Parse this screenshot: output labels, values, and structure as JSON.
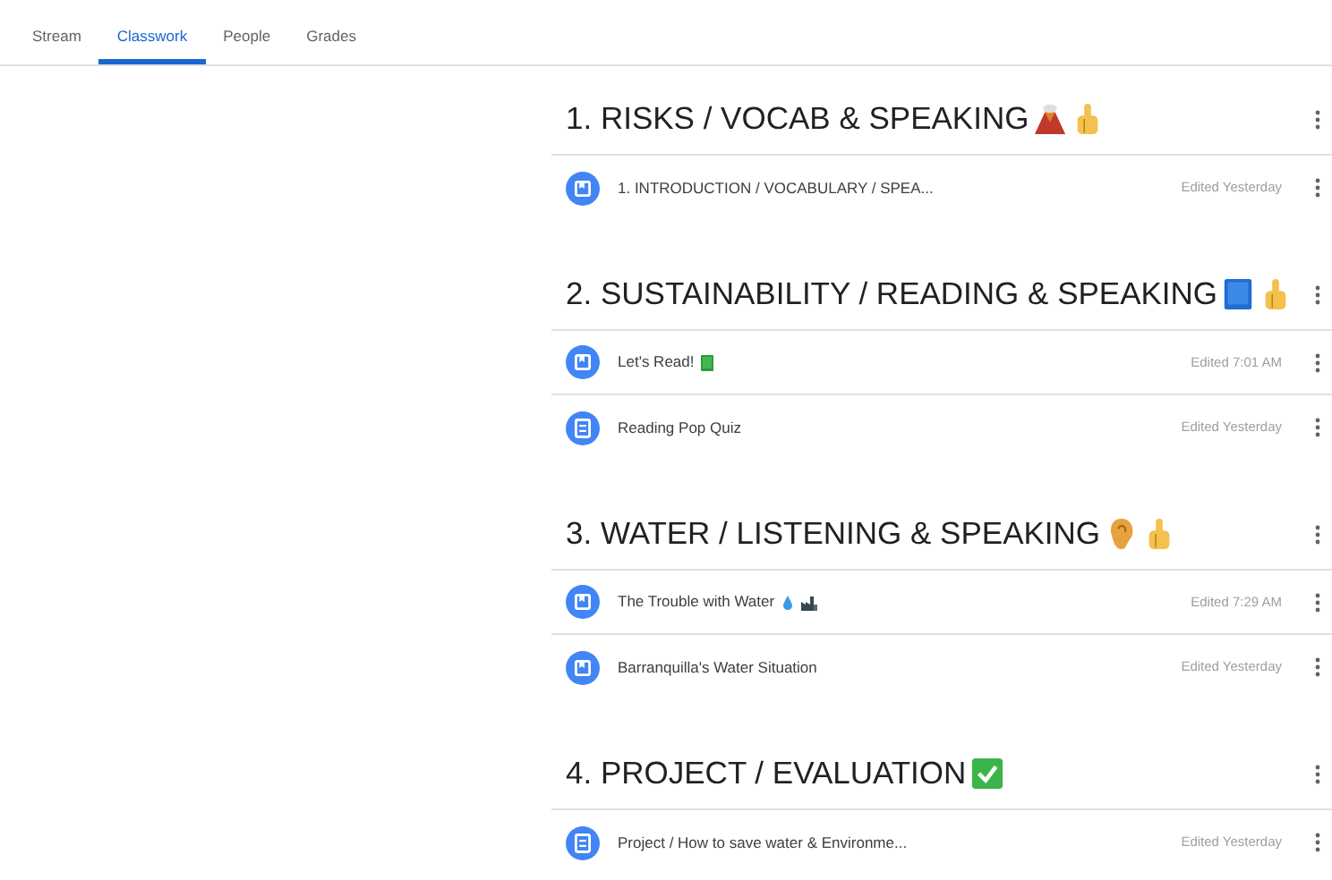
{
  "tabs": [
    {
      "label": "Stream",
      "selected": false
    },
    {
      "label": "Classwork",
      "selected": true
    },
    {
      "label": "People",
      "selected": false
    },
    {
      "label": "Grades",
      "selected": false
    }
  ],
  "topics": [
    {
      "title": "1. RISKS / VOCAB & SPEAKING",
      "icons": [
        {
          "kind": "volcano"
        },
        {
          "kind": "hand"
        }
      ],
      "items": [
        {
          "kind": "material",
          "title": "1. INTRODUCTION / VOCABULARY / SPEA...",
          "edited": "Edited Yesterday"
        }
      ]
    },
    {
      "title": "2. SUSTAINABILITY / READING & SPEAKING",
      "icons": [
        {
          "kind": "bluebook"
        },
        {
          "kind": "hand"
        }
      ],
      "items": [
        {
          "kind": "material",
          "title": "Let's Read!",
          "icons": [
            {
              "kind": "greenbook"
            }
          ],
          "edited": "Edited 7:01 AM"
        },
        {
          "kind": "quiz",
          "title": "Reading Pop Quiz",
          "edited": "Edited Yesterday"
        }
      ]
    },
    {
      "title": "3. WATER / LISTENING & SPEAKING",
      "icons": [
        {
          "kind": "ear"
        },
        {
          "kind": "hand"
        }
      ],
      "items": [
        {
          "kind": "material",
          "title": "The Trouble with Water",
          "icons": [
            {
              "kind": "droplet"
            },
            {
              "kind": "factory"
            }
          ],
          "edited": "Edited 7:29 AM"
        },
        {
          "kind": "material",
          "title": "Barranquilla's Water Situation",
          "edited": "Edited Yesterday"
        }
      ]
    },
    {
      "title": "4. PROJECT / EVALUATION",
      "icons": [
        {
          "kind": "check"
        }
      ],
      "items": [
        {
          "kind": "quiz",
          "title": "Project / How to save water & Environme...",
          "edited": "Edited Yesterday"
        }
      ]
    }
  ]
}
